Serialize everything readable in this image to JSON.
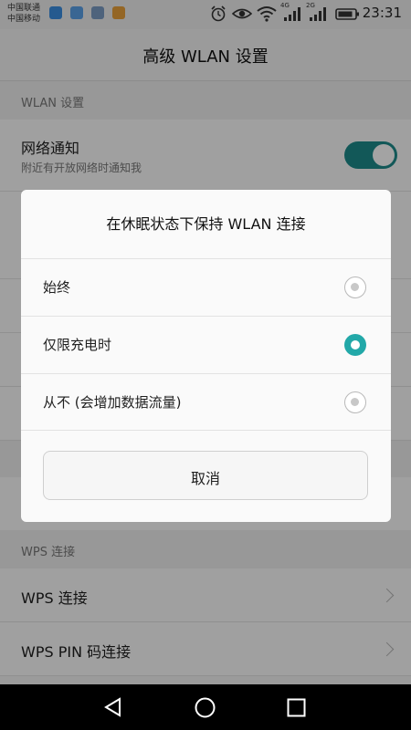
{
  "status_bar": {
    "carriers": [
      "中国联通",
      "中国移动"
    ],
    "network_labels": [
      "4G",
      "2G"
    ],
    "time": "23:31",
    "icons": [
      "alarm-icon",
      "eye-icon",
      "wifi-icon",
      "signal-4g-icon",
      "signal-2g-icon",
      "battery-icon"
    ]
  },
  "header": {
    "title": "高级 WLAN 设置"
  },
  "sections": {
    "wlan_settings": "WLAN 设置",
    "wps": "WPS 连接"
  },
  "settings": {
    "network_notify": {
      "title": "网络通知",
      "subtitle": "附近有开放网络时通知我",
      "enabled": true
    }
  },
  "dialog": {
    "title": "在休眠状态下保持 WLAN 连接",
    "options": [
      {
        "label": "始终",
        "selected": false
      },
      {
        "label": "仅限充电时",
        "selected": true
      },
      {
        "label": "从不 (会增加数据流量)",
        "selected": false
      }
    ],
    "cancel_label": "取消"
  },
  "wps": {
    "items": [
      {
        "label": "WPS 连接"
      },
      {
        "label": "WPS PIN 码连接"
      }
    ]
  },
  "nav": {
    "icons": [
      "back-icon",
      "home-icon",
      "recents-icon"
    ]
  },
  "colors": {
    "accent": "#22a8a8",
    "toggle": "#1d8a8a"
  }
}
